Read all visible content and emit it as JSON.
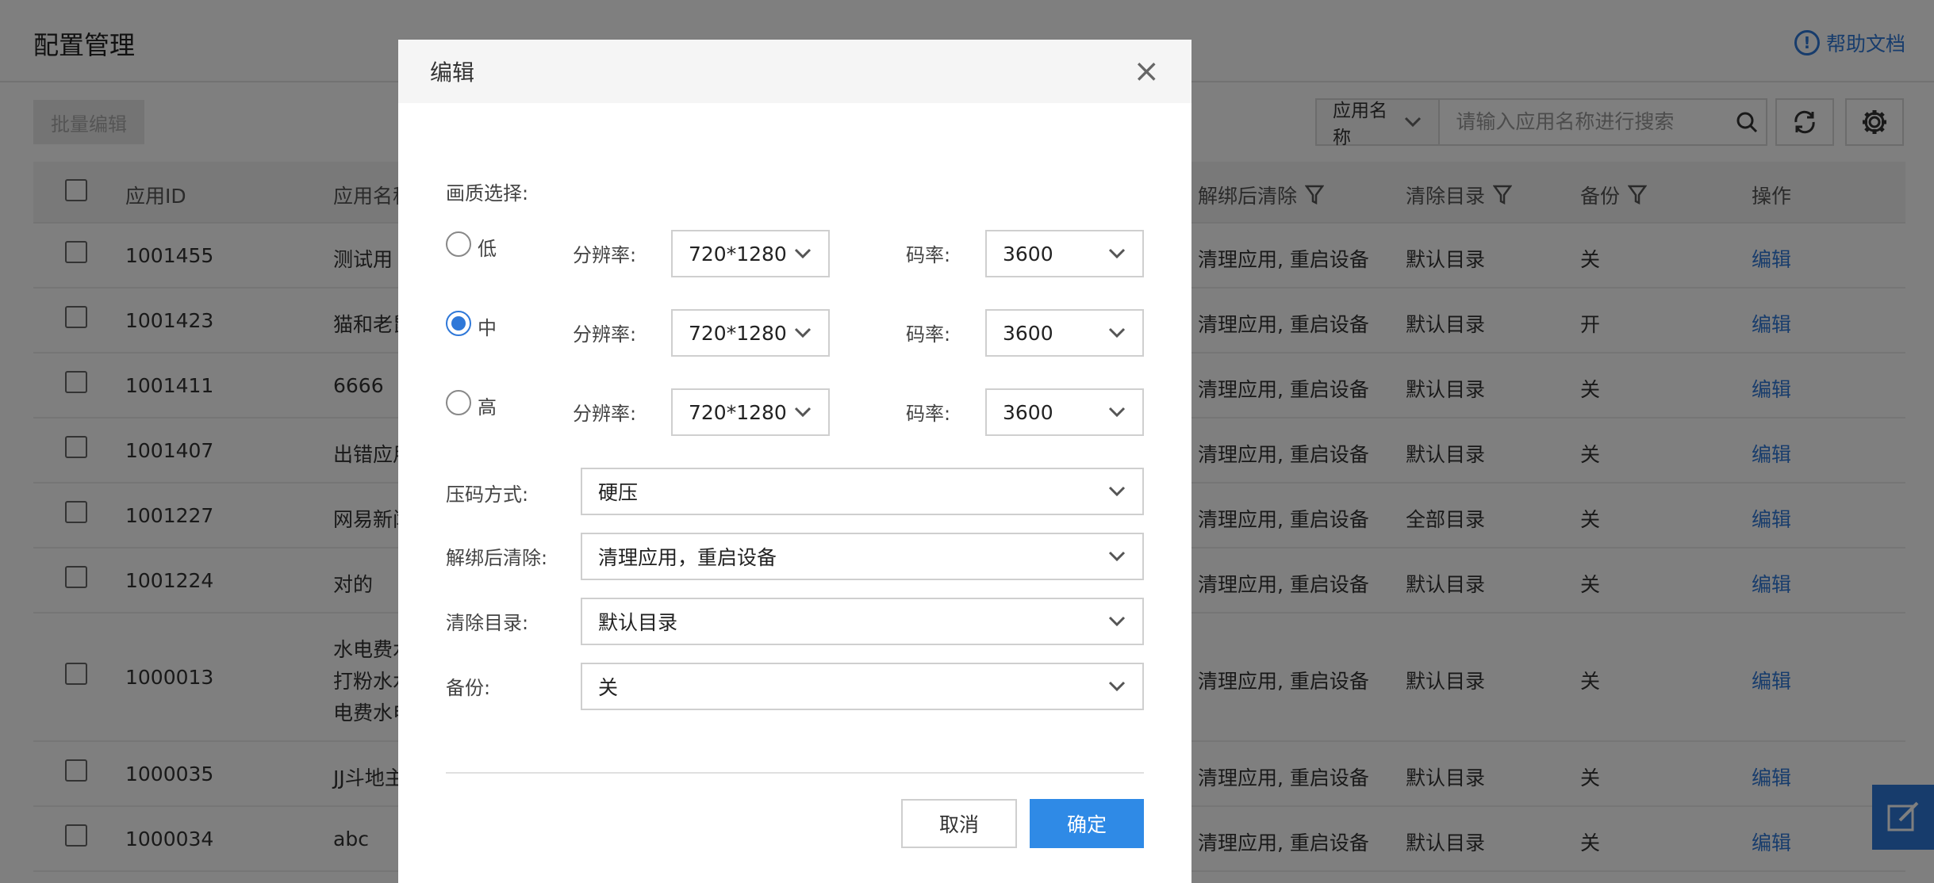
{
  "page": {
    "title": "配置管理",
    "help_label": "帮助文档",
    "batch_edit_label": "批量编辑",
    "search": {
      "field_label": "应用名称",
      "placeholder": "请输入应用名称进行搜索"
    },
    "table": {
      "headers": {
        "app_id": "应用ID",
        "app_name": "应用名称",
        "unbind_clear": "解绑后清除",
        "clear_dir": "清除目录",
        "backup": "备份",
        "action": "操作"
      },
      "rows": [
        {
          "id": "1001455",
          "name": "测试用",
          "clear": "清理应用, 重启设备",
          "dir": "默认目录",
          "backup": "关",
          "action": "编辑"
        },
        {
          "id": "1001423",
          "name": "猫和老鼠",
          "clear": "清理应用, 重启设备",
          "dir": "默认目录",
          "backup": "开",
          "action": "编辑"
        },
        {
          "id": "1001411",
          "name": "6666",
          "clear": "清理应用, 重启设备",
          "dir": "默认目录",
          "backup": "关",
          "action": "编辑"
        },
        {
          "id": "1001407",
          "name": "出错应用",
          "clear": "清理应用, 重启设备",
          "dir": "默认目录",
          "backup": "关",
          "action": "编辑"
        },
        {
          "id": "1001227",
          "name": "网易新闻",
          "clear": "清理应用, 重启设备",
          "dir": "全部目录",
          "backup": "关",
          "action": "编辑"
        },
        {
          "id": "1001224",
          "name": "对的",
          "clear": "清理应用, 重启设备",
          "dir": "默认目录",
          "backup": "关",
          "action": "编辑"
        },
        {
          "id": "1000013",
          "name": "水电费水",
          "name2": "打粉水水",
          "name3": "电费水电",
          "clear": "清理应用, 重启设备",
          "dir": "默认目录",
          "backup": "关",
          "action": "编辑"
        },
        {
          "id": "1000035",
          "name": "JJ斗地主",
          "clear": "清理应用, 重启设备",
          "dir": "默认目录",
          "backup": "关",
          "action": "编辑"
        },
        {
          "id": "1000034",
          "name": "abc",
          "clear": "清理应用, 重启设备",
          "dir": "默认目录",
          "backup": "关",
          "action": "编辑"
        }
      ]
    }
  },
  "modal": {
    "title": "编辑",
    "close_icon": "×",
    "quality_label": "画质选择:",
    "resolution_label": "分辨率:",
    "bitrate_label": "码率:",
    "qualities": [
      {
        "label": "低",
        "checked": false,
        "resolution": "720*1280",
        "bitrate": "3600"
      },
      {
        "label": "中",
        "checked": true,
        "resolution": "720*1280",
        "bitrate": "3600"
      },
      {
        "label": "高",
        "checked": false,
        "resolution": "720*1280",
        "bitrate": "3600"
      }
    ],
    "compression": {
      "label": "压码方式:",
      "value": "硬压"
    },
    "unbind_clear": {
      "label": "解绑后清除:",
      "value": "清理应用，重启设备"
    },
    "clear_dir": {
      "label": "清除目录:",
      "value": "默认目录"
    },
    "backup": {
      "label": "备份:",
      "value": "关"
    },
    "cancel_label": "取消",
    "ok_label": "确定"
  },
  "colors": {
    "accent": "#2f78d8",
    "primary_button": "#2f8ae6",
    "overlay": "rgba(0,0,0,0.5)"
  }
}
